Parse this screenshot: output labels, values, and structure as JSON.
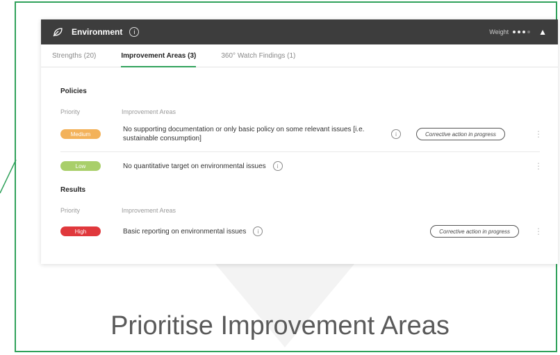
{
  "header": {
    "title": "Environment",
    "weight_label": "Weight",
    "leaf_icon": "leaf-icon",
    "info_icon": "info-icon",
    "expand_icon": "chevron-up-icon"
  },
  "tabs": [
    {
      "label": "Strengths (20)",
      "active": false
    },
    {
      "label": "Improvement Areas (3)",
      "active": true
    },
    {
      "label": "360° Watch Findings (1)",
      "active": false
    }
  ],
  "sections": [
    {
      "title": "Policies",
      "priority_label": "Priority",
      "areas_label": "Improvement Areas",
      "rows": [
        {
          "priority": "Medium",
          "priority_color": "#f3b25a",
          "text": "No supporting documentation or only basic policy on some relevant issues [i.e. sustainable consumption]",
          "action": "Corrective action in progress"
        },
        {
          "priority": "Low",
          "priority_color": "#a9cf6a",
          "text": "No quantitative target on environmental issues",
          "action": ""
        }
      ]
    },
    {
      "title": "Results",
      "priority_label": "Priority",
      "areas_label": "Improvement Areas",
      "rows": [
        {
          "priority": "High",
          "priority_color": "#e0383c",
          "text": "Basic reporting on environmental issues",
          "action": "Corrective action in progress"
        }
      ]
    }
  ],
  "caption": "Prioritise Improvement Areas",
  "colors": {
    "accent": "#2fa15a",
    "header_bg": "#3d3d3d"
  }
}
